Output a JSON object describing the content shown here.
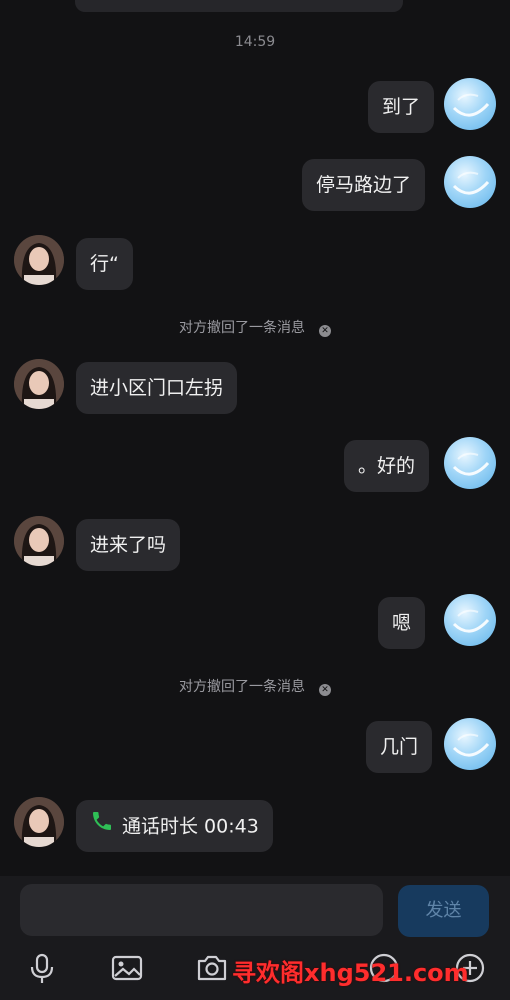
{
  "timestamp": "14:59",
  "messages": [
    {
      "side": "me",
      "text": "到了"
    },
    {
      "side": "me",
      "text": "停马路边了"
    },
    {
      "side": "her",
      "text": "行“"
    },
    {
      "side": "notice",
      "text": "对方撤回了一条消息"
    },
    {
      "side": "her",
      "text": "进小区门口左拐"
    },
    {
      "side": "me",
      "text": "。好的"
    },
    {
      "side": "her",
      "text": "进来了吗"
    },
    {
      "side": "me",
      "text": "嗯"
    },
    {
      "side": "notice",
      "text": "对方撤回了一条消息"
    },
    {
      "side": "me",
      "text": "几门"
    },
    {
      "side": "her",
      "text": "通话时长 00:43",
      "type": "call"
    }
  ],
  "input": {
    "placeholder": ""
  },
  "send_label": "发送",
  "toolbar": [
    "microphone-icon",
    "image-icon",
    "camera-icon",
    "emoji-icon",
    "plus-icon"
  ],
  "watermark": "寻欢阁xhg521.com",
  "colors": {
    "background": "#121214",
    "bubble": "#2a2a2e",
    "send": "#173a5e",
    "call": "#2fbf56",
    "watermark": "#ff2d2d"
  }
}
